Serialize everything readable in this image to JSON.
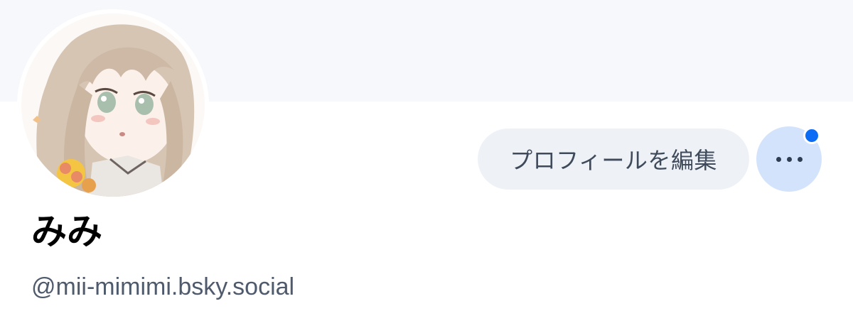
{
  "profile": {
    "display_name": "みみ",
    "handle": "@mii-mimimi.bsky.social"
  },
  "actions": {
    "edit_profile_label": "プロフィールを編集"
  },
  "icons": {
    "more": "ellipsis-icon",
    "notification": "notification-dot"
  },
  "colors": {
    "banner": "#f6f8fb",
    "edit_button_bg": "#eef2f7",
    "more_button_bg": "#d3e3fb",
    "notification_dot": "#0a6cf5",
    "handle_text": "#4f5b6d"
  }
}
